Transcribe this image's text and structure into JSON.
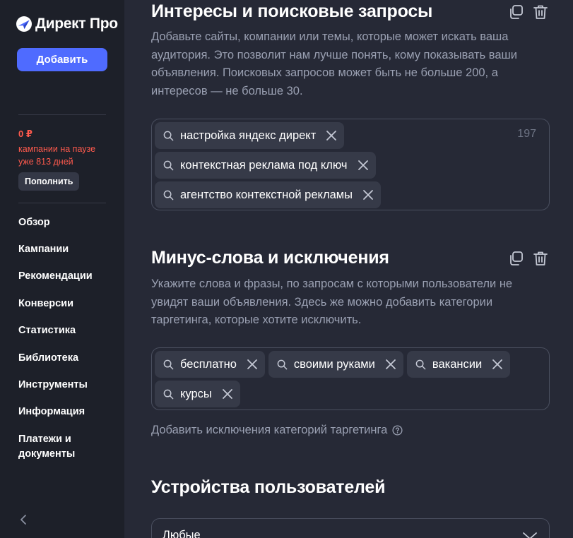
{
  "colors": {
    "sidebar_bg": "#1d2029",
    "main_bg": "#262936",
    "accent": "#4f6bff",
    "alert": "#ff5a4d",
    "chip_bg": "#363a48",
    "muted_text": "#9aa0b2"
  },
  "sidebar": {
    "logo_text": "Директ Про",
    "logo_icon": "yandex-direct-logo-icon",
    "add_button": "Добавить",
    "balance": "0 ₽",
    "paused_text": "кампании на паузе уже 813 дней",
    "topup_button": "Пополнить",
    "nav": [
      "Обзор",
      "Кампании",
      "Рекомендации",
      "Конверсии",
      "Статистика",
      "Библиотека",
      "Инструменты",
      "Информация",
      "Платежи и документы"
    ],
    "collapse_icon": "chevron-left-icon"
  },
  "interests": {
    "title": "Интересы и поисковые запросы",
    "description": "Добавьте сайты, компании или темы, которые может искать ваша аудитория. Это позволит нам лучше понять, кому показывать ваши объявления. Поисковых запросов может быть не больше 200, а интересов — не больше 30.",
    "counter": "197",
    "chips": [
      "настройка яндекс директ",
      "контекстная реклама под ключ",
      "агентство контекстной рекламы"
    ]
  },
  "minus_words": {
    "title": "Минус-слова и исключения",
    "description": "Укажите слова и фразы, по запросам с которыми пользователи не увидят ваши объявления. Здесь же можно добавить категории таргетинга, которые хотите исключить.",
    "chips": [
      "бесплатно",
      "своими руками",
      "вакансии",
      "курсы"
    ],
    "add_link": "Добавить исключения категорий таргетинга"
  },
  "devices": {
    "title": "Устройства пользователей",
    "selected": "Любые"
  }
}
